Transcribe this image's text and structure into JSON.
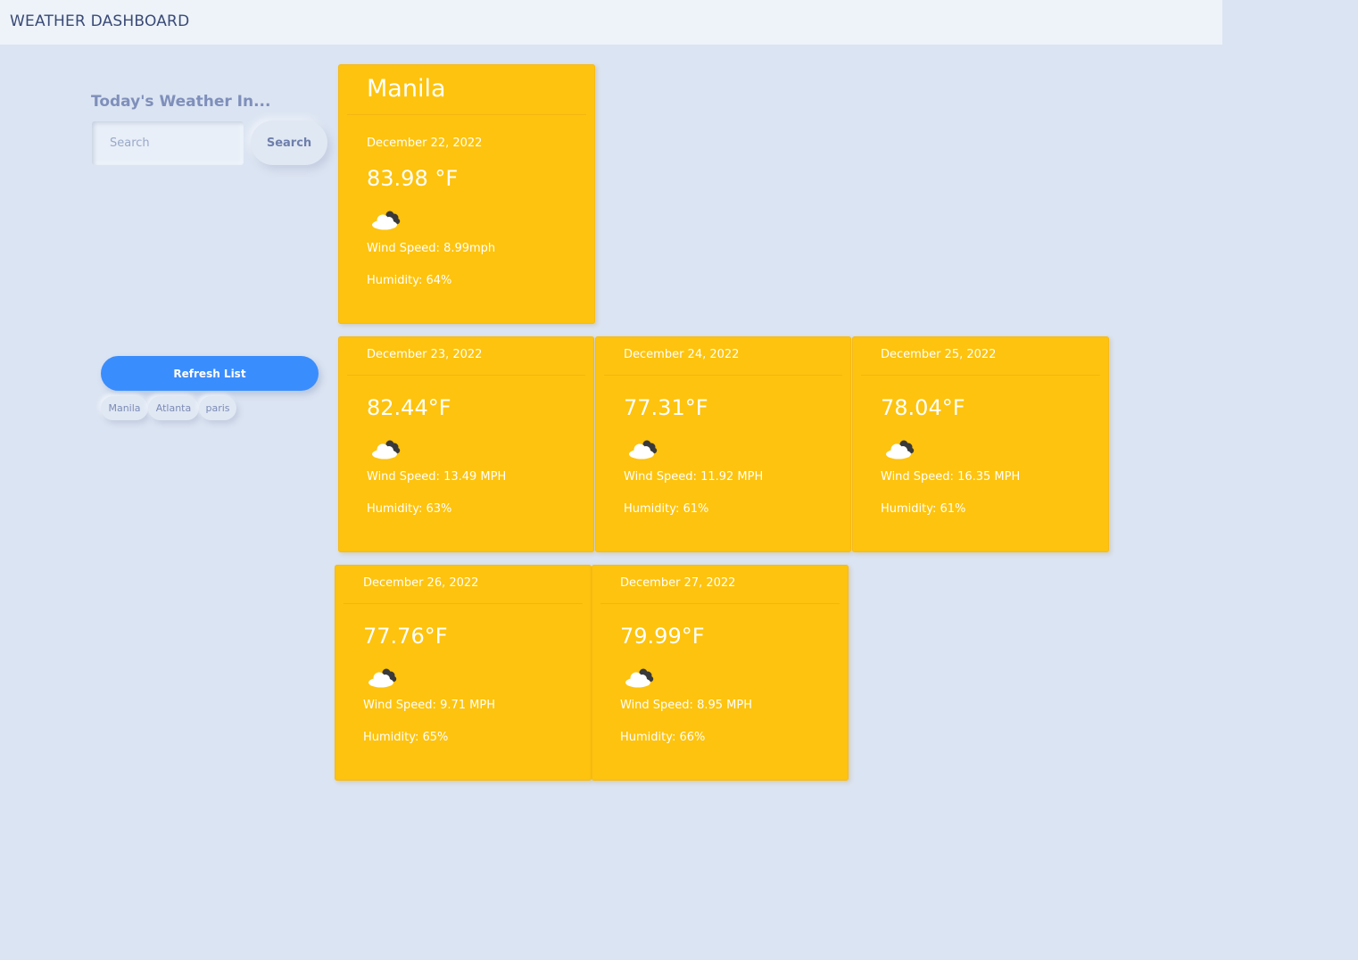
{
  "app": {
    "title": "WEATHER DASHBOARD"
  },
  "search": {
    "heading": "Today's Weather In...",
    "placeholder": "Search",
    "button_label": "Search"
  },
  "history": {
    "refresh_label": "Refresh List",
    "items": [
      "Manila",
      "Atlanta",
      "paris"
    ]
  },
  "current": {
    "city": "Manila",
    "date": "December 22, 2022",
    "temp": "83.98 °F",
    "icon": "partly-cloudy-night-icon",
    "wind": "Wind Speed: 8.99mph",
    "humidity": "Humidity: 64%"
  },
  "forecast": [
    {
      "date": "December 23, 2022",
      "temp": "82.44°F",
      "icon": "partly-cloudy-night-icon",
      "wind": "Wind Speed: 13.49 MPH",
      "humidity": "Humidity: 63%"
    },
    {
      "date": "December 24, 2022",
      "temp": "77.31°F",
      "icon": "partly-cloudy-night-icon",
      "wind": "Wind Speed: 11.92 MPH",
      "humidity": "Humidity: 61%"
    },
    {
      "date": "December 25, 2022",
      "temp": "78.04°F",
      "icon": "partly-cloudy-night-icon",
      "wind": "Wind Speed: 16.35 MPH",
      "humidity": "Humidity: 61%"
    },
    {
      "date": "December 26, 2022",
      "temp": "77.76°F",
      "icon": "partly-cloudy-night-icon",
      "wind": "Wind Speed: 9.71 MPH",
      "humidity": "Humidity: 65%"
    },
    {
      "date": "December 27, 2022",
      "temp": "79.99°F",
      "icon": "partly-cloudy-night-icon",
      "wind": "Wind Speed: 8.95 MPH",
      "humidity": "Humidity: 66%"
    }
  ],
  "colors": {
    "background": "#dbe4f2",
    "card": "#fdc30e",
    "accent": "#3a8dfd",
    "title_text": "#3a4a76"
  }
}
